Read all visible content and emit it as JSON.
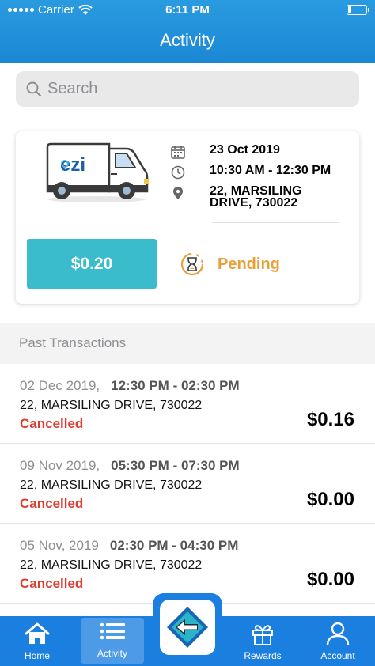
{
  "status_bar": {
    "carrier": "Carrier",
    "time": "6:11 PM"
  },
  "header": {
    "title": "Activity"
  },
  "search": {
    "placeholder": "Search"
  },
  "booking": {
    "van_logo_text": "ezi",
    "date": "23 Oct 2019",
    "time": "10:30 AM - 12:30 PM",
    "address": "22, MARSILING DRIVE, 730022",
    "amount": "$0.20",
    "status": "Pending"
  },
  "past": {
    "header": "Past Transactions",
    "items": [
      {
        "date": "02 Dec 2019,",
        "time": "12:30 PM - 02:30 PM",
        "address": "22, MARSILING DRIVE, 730022",
        "status": "Cancelled",
        "amount": "$0.16"
      },
      {
        "date": "09 Nov 2019,",
        "time": "05:30 PM - 07:30 PM",
        "address": "22, MARSILING DRIVE, 730022",
        "status": "Cancelled",
        "amount": "$0.00"
      },
      {
        "date": "05 Nov, 2019",
        "time": "02:30 PM - 04:30 PM",
        "address": "22, MARSILING DRIVE, 730022",
        "status": "Cancelled",
        "amount": "$0.00"
      }
    ]
  },
  "nav": {
    "tabs": [
      {
        "label": "Home",
        "icon": "home-icon"
      },
      {
        "label": "Activity",
        "icon": "list-icon",
        "active": true
      },
      {
        "label": "Rewards",
        "icon": "gift-icon"
      },
      {
        "label": "Account",
        "icon": "person-icon"
      }
    ],
    "center_icon": "arrow-left-icon"
  },
  "colors": {
    "header": "#1b87d4",
    "amount_button": "#3bbccc",
    "pending": "#e8a03a",
    "cancelled": "#e03b2e",
    "nav": "#1b7fe0"
  }
}
